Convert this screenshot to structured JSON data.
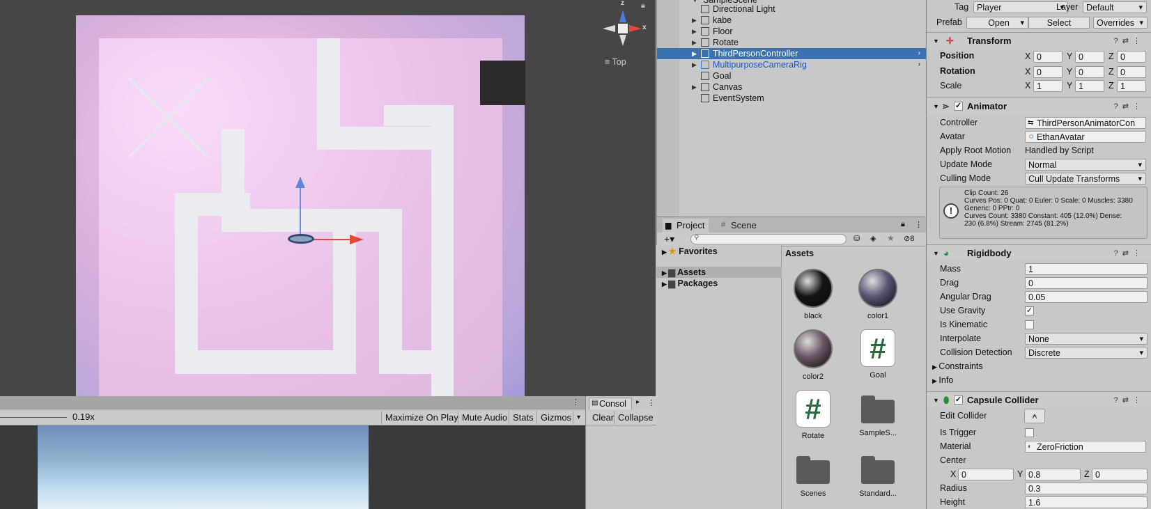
{
  "scene": {
    "view_label": "Top",
    "axis_z": "z",
    "axis_x": "x"
  },
  "game": {
    "scale": "0.19x",
    "buttons": [
      "Maximize On Play",
      "Mute Audio",
      "Stats",
      "Gizmos"
    ]
  },
  "console": {
    "tab": "Consol",
    "buttons": [
      "Clear",
      "Collapse"
    ]
  },
  "hierarchy": {
    "scene_name": "SampleScene",
    "items": [
      {
        "label": "Directional Light",
        "arrow": ""
      },
      {
        "label": "kabe",
        "arrow": "▶"
      },
      {
        "label": "Floor",
        "arrow": "▶"
      },
      {
        "label": "Rotate",
        "arrow": "▶"
      },
      {
        "label": "ThirdPersonController",
        "arrow": "▶"
      },
      {
        "label": "MultipurposeCameraRig",
        "arrow": "▶"
      },
      {
        "label": "Goal",
        "arrow": ""
      },
      {
        "label": "Canvas",
        "arrow": "▶"
      },
      {
        "label": "EventSystem",
        "arrow": ""
      }
    ]
  },
  "project": {
    "tab_project": "Project",
    "tab_scene": "Scene",
    "hidden_count": "8",
    "favorites": "Favorites",
    "assets": "Assets",
    "packages": "Packages",
    "breadcrumb": "Assets",
    "items": [
      {
        "name": "black",
        "kind": "sphere",
        "color": "#141414"
      },
      {
        "name": "color1",
        "kind": "sphere",
        "color": "#5b5474"
      },
      {
        "name": "color2",
        "kind": "sphere",
        "color": "#6b5566"
      },
      {
        "name": "Goal",
        "kind": "script"
      },
      {
        "name": "Rotate",
        "kind": "script"
      },
      {
        "name": "SampleS...",
        "kind": "folder"
      },
      {
        "name": "Scenes",
        "kind": "folder"
      },
      {
        "name": "Standard...",
        "kind": "folder"
      }
    ]
  },
  "inspector": {
    "tag_label": "Tag",
    "tag_value": "Player",
    "layer_label": "Layer",
    "layer_value": "Default",
    "prefab_label": "Prefab",
    "prefab_open": "Open",
    "prefab_select": "Select",
    "prefab_overrides": "Overrides",
    "transform": {
      "title": "Transform",
      "position_label": "Position",
      "rotation_label": "Rotation",
      "scale_label": "Scale",
      "position": [
        "0",
        "0",
        "0"
      ],
      "rotation": [
        "0",
        "0",
        "0"
      ],
      "scale": [
        "1",
        "1",
        "1"
      ]
    },
    "animator": {
      "title": "Animator",
      "controller_label": "Controller",
      "controller_value": "ThirdPersonAnimatorCon",
      "avatar_label": "Avatar",
      "avatar_value": "EthanAvatar",
      "root_motion_label": "Apply Root Motion",
      "root_motion_value": "Handled by Script",
      "update_mode_label": "Update Mode",
      "update_mode_value": "Normal",
      "culling_label": "Culling Mode",
      "culling_value": "Cull Update Transforms",
      "info_lines": [
        "Clip Count: 26",
        "Curves Pos: 0 Quat: 0 Euler: 0 Scale: 0 Muscles: 3380",
        "Generic: 0 PPtr: 0",
        "Curves Count: 3380 Constant: 405 (12.0%) Dense:",
        "230 (6.8%) Stream: 2745 (81.2%)"
      ]
    },
    "rigidbody": {
      "title": "Rigidbody",
      "mass_label": "Mass",
      "mass": "1",
      "drag_label": "Drag",
      "drag": "0",
      "angular_label": "Angular Drag",
      "angular": "0.05",
      "gravity_label": "Use Gravity",
      "kinematic_label": "Is Kinematic",
      "interpolate_label": "Interpolate",
      "interpolate": "None",
      "collision_label": "Collision Detection",
      "collision": "Discrete",
      "constraints_label": "Constraints",
      "info_label": "Info"
    },
    "capsule": {
      "title": "Capsule Collider",
      "edit_label": "Edit Collider",
      "trigger_label": "Is Trigger",
      "material_label": "Material",
      "material": "ZeroFriction",
      "center_label": "Center",
      "center": [
        "0",
        "0.8",
        "0"
      ],
      "radius_label": "Radius",
      "radius": "0.3",
      "height_label": "Height",
      "height": "1.6"
    }
  }
}
